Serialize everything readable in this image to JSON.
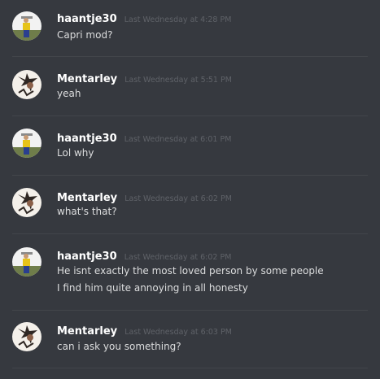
{
  "messages": [
    {
      "username": "haantje30",
      "timestamp": "Last Wednesday at 4:28 PM",
      "avatar_icon": "soccer-player-avatar",
      "lines": [
        "Capri mod?"
      ]
    },
    {
      "username": "Mentarley",
      "timestamp": "Last Wednesday at 5:51 PM",
      "avatar_icon": "sketch-character-avatar",
      "lines": [
        "yeah"
      ]
    },
    {
      "username": "haantje30",
      "timestamp": "Last Wednesday at 6:01 PM",
      "avatar_icon": "soccer-player-avatar",
      "lines": [
        "Lol why"
      ]
    },
    {
      "username": "Mentarley",
      "timestamp": "Last Wednesday at 6:02 PM",
      "avatar_icon": "sketch-character-avatar",
      "lines": [
        "what's that?"
      ]
    },
    {
      "username": "haantje30",
      "timestamp": "Last Wednesday at 6:02 PM",
      "avatar_icon": "soccer-player-avatar",
      "lines": [
        "He isnt exactly the most loved person by some people",
        "I find him quite annoying in all honesty"
      ]
    },
    {
      "username": "Mentarley",
      "timestamp": "Last Wednesday at 6:03 PM",
      "avatar_icon": "sketch-character-avatar",
      "lines": [
        "can i ask you something?"
      ]
    }
  ],
  "colors": {
    "background": "#36393f",
    "username": "#ffffff",
    "timestamp": "#5f6268",
    "message_text": "#dcddde",
    "divider": "#42454a"
  }
}
